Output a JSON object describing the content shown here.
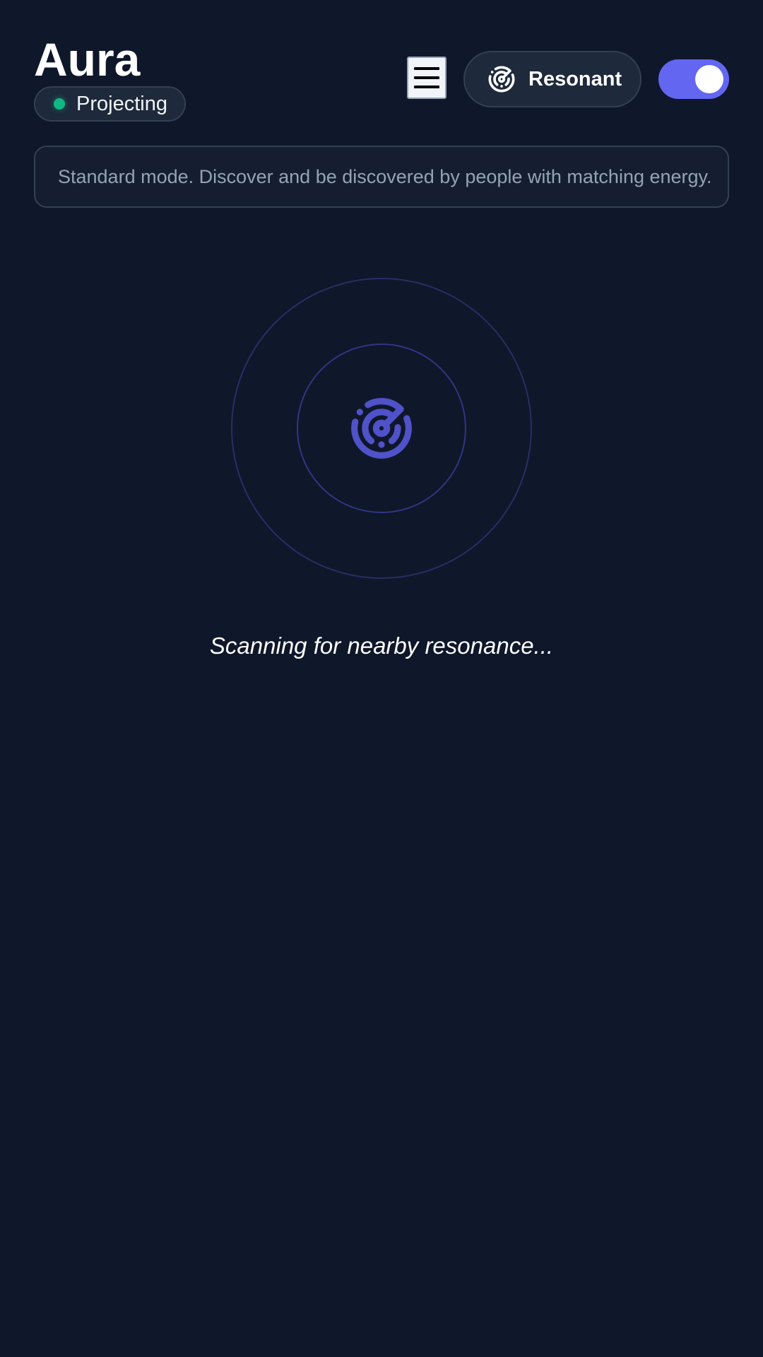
{
  "header": {
    "app_title": "Aura",
    "status": {
      "label": "Projecting",
      "color": "#10b981"
    },
    "menu_icon": "hamburger-menu-icon",
    "mode_button": {
      "label": "Resonant",
      "icon": "radar-icon"
    },
    "toggle": {
      "state": "on",
      "color": "#6366f1"
    }
  },
  "info_box": {
    "text": "Standard mode. Discover and be discovered by people with matching energy."
  },
  "radar": {
    "icon": "radar-icon",
    "accent_color": "#4f52c8"
  },
  "scan_status": {
    "text": "Scanning for nearby resonance..."
  },
  "colors": {
    "background": "#0f172a",
    "surface": "#1e293b",
    "border": "#334155",
    "muted_text": "#94a3b8"
  }
}
